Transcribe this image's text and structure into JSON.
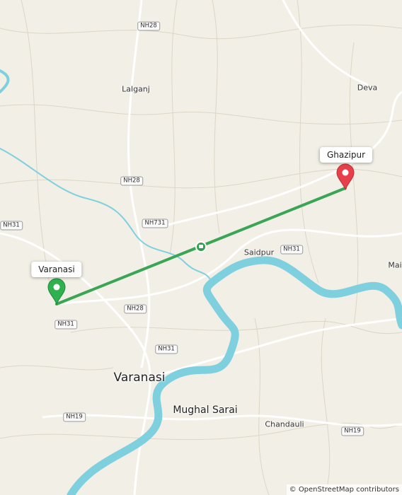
{
  "map": {
    "places": [
      {
        "name": "Lalganj"
      },
      {
        "name": "Deva"
      },
      {
        "name": "Saidpur"
      },
      {
        "name": "Varanasi"
      },
      {
        "name": "Mughal Sarai"
      },
      {
        "name": "Chandauli"
      },
      {
        "name": "Mai"
      }
    ],
    "road_shields": [
      "NH28",
      "NH28",
      "NH731",
      "NH31",
      "NH31",
      "NH28",
      "NH31",
      "NH31",
      "NH19",
      "NH19"
    ],
    "route": {
      "color": "#3aa655",
      "start": {
        "label": "Varanasi",
        "color": "#2fb14f"
      },
      "end": {
        "label": "Ghazipur",
        "color": "#e8404a"
      }
    },
    "attribution": {
      "symbol": "©",
      "text": "OpenStreetMap contributors"
    },
    "colors": {
      "water": "#7fd0df",
      "land": "#f2efe6",
      "road": "#ffffff"
    }
  }
}
